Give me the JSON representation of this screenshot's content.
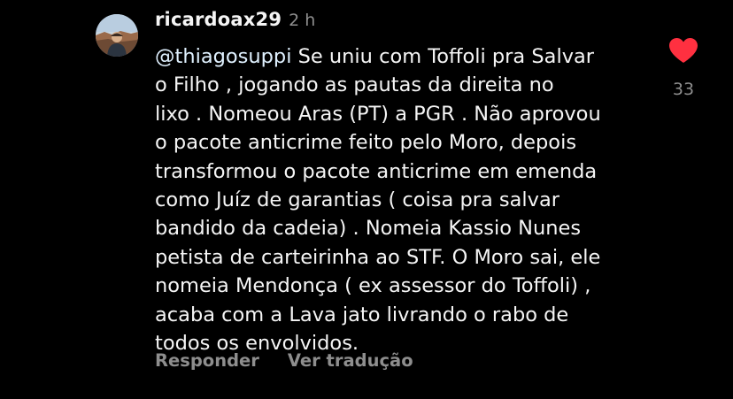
{
  "comment": {
    "username": "ricardoax29",
    "timestamp": "2 h",
    "mention": "@thiagosuppi",
    "lines": [
      " Se uniu com Toffoli pra Salvar",
      "o Filho , jogando as pautas da direita no",
      "lixo . Nomeou Aras (PT) a PGR . Não aprovou",
      "o pacote anticrime feito pelo Moro, depois",
      "transformou o pacote anticrime em emenda",
      "como Juíz de garantias ( coisa pra salvar",
      "bandido da cadeia) . Nomeia Kassio Nunes",
      "petista de carteirinha ao STF. O Moro sai, ele",
      "nomeia Mendonça ( ex assessor do Toffoli) ,",
      "acaba com a Lava jato livrando o rabo de",
      "todos os envolvidos."
    ],
    "actions": {
      "reply_label": "Responder",
      "translate_label": "Ver tradução"
    },
    "likes": {
      "count": "33",
      "icon": "heart-icon",
      "liked": true,
      "color": "#ff3040"
    }
  },
  "colors": {
    "background": "#000000",
    "text": "#f5f5f5",
    "secondary": "#8e8e8e",
    "mention": "#e0f1ff"
  }
}
